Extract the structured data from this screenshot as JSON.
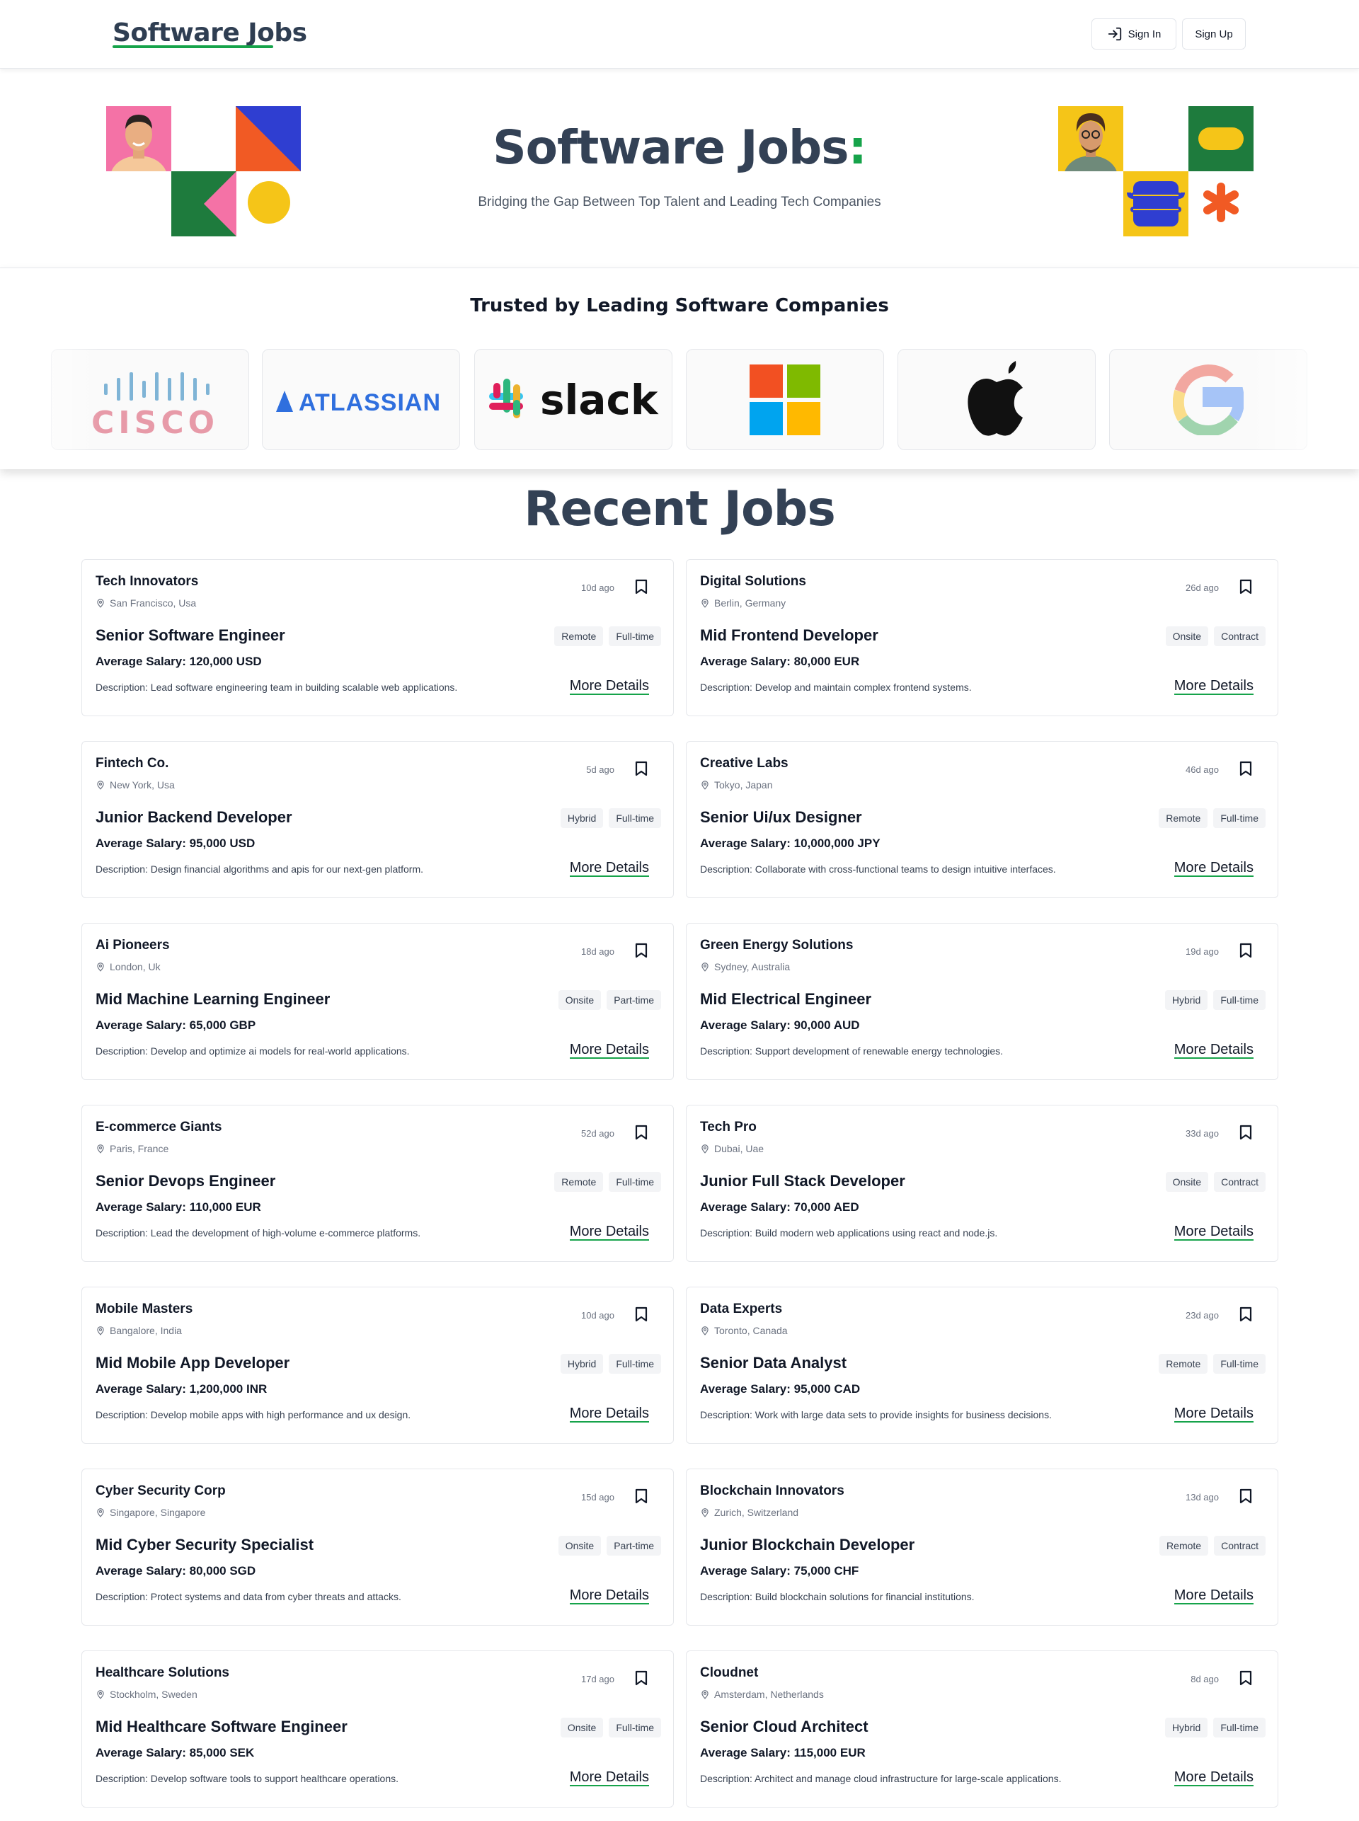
{
  "nav": {
    "brand": "Software Jobs",
    "signin": "Sign In",
    "signup": "Sign Up"
  },
  "hero": {
    "title": "Software Jobs",
    "title_accent": ":",
    "subtitle": "Bridging the Gap Between Top Talent and Leading Tech Companies"
  },
  "trusted": {
    "heading": "Trusted by Leading Software Companies",
    "logos": [
      "cisco",
      "atlassian",
      "slack",
      "microsoft",
      "apple",
      "google"
    ],
    "cisco_text": "CISCO",
    "atlassian_text": "ATLASSIAN",
    "slack_text": "slack"
  },
  "recent": {
    "title": "Recent Jobs"
  },
  "colors": {
    "accent": "#16a34a",
    "heading": "#334155"
  },
  "jobs": [
    {
      "company": "Tech Innovators",
      "location": "San Francisco, Usa",
      "ago": "10d ago",
      "title": "Senior Software Engineer",
      "tags": [
        "Remote",
        "Full-time"
      ],
      "salary": "Average Salary: 120,000 USD",
      "description": "Description: Lead software engineering team in building scalable web applications.",
      "more": "More Details"
    },
    {
      "company": "Digital Solutions",
      "location": "Berlin, Germany",
      "ago": "26d ago",
      "title": "Mid Frontend Developer",
      "tags": [
        "Onsite",
        "Contract"
      ],
      "salary": "Average Salary: 80,000 EUR",
      "description": "Description: Develop and maintain complex frontend systems.",
      "more": "More Details"
    },
    {
      "company": "Fintech Co.",
      "location": "New York, Usa",
      "ago": "5d ago",
      "title": "Junior Backend Developer",
      "tags": [
        "Hybrid",
        "Full-time"
      ],
      "salary": "Average Salary: 95,000 USD",
      "description": "Description: Design financial algorithms and apis for our next-gen platform.",
      "more": "More Details"
    },
    {
      "company": "Creative Labs",
      "location": "Tokyo, Japan",
      "ago": "46d ago",
      "title": "Senior Ui/ux Designer",
      "tags": [
        "Remote",
        "Full-time"
      ],
      "salary": "Average Salary: 10,000,000 JPY",
      "description": "Description: Collaborate with cross-functional teams to design intuitive interfaces.",
      "more": "More Details"
    },
    {
      "company": "Ai Pioneers",
      "location": "London, Uk",
      "ago": "18d ago",
      "title": "Mid Machine Learning Engineer",
      "tags": [
        "Onsite",
        "Part-time"
      ],
      "salary": "Average Salary: 65,000 GBP",
      "description": "Description: Develop and optimize ai models for real-world applications.",
      "more": "More Details"
    },
    {
      "company": "Green Energy Solutions",
      "location": "Sydney, Australia",
      "ago": "19d ago",
      "title": "Mid Electrical Engineer",
      "tags": [
        "Hybrid",
        "Full-time"
      ],
      "salary": "Average Salary: 90,000 AUD",
      "description": "Description: Support development of renewable energy technologies.",
      "more": "More Details"
    },
    {
      "company": "E-commerce Giants",
      "location": "Paris, France",
      "ago": "52d ago",
      "title": "Senior Devops Engineer",
      "tags": [
        "Remote",
        "Full-time"
      ],
      "salary": "Average Salary: 110,000 EUR",
      "description": "Description: Lead the development of high-volume e-commerce platforms.",
      "more": "More Details"
    },
    {
      "company": "Tech Pro",
      "location": "Dubai, Uae",
      "ago": "33d ago",
      "title": "Junior Full Stack Developer",
      "tags": [
        "Onsite",
        "Contract"
      ],
      "salary": "Average Salary: 70,000 AED",
      "description": "Description: Build modern web applications using react and node.js.",
      "more": "More Details"
    },
    {
      "company": "Mobile Masters",
      "location": "Bangalore, India",
      "ago": "10d ago",
      "title": "Mid Mobile App Developer",
      "tags": [
        "Hybrid",
        "Full-time"
      ],
      "salary": "Average Salary: 1,200,000 INR",
      "description": "Description: Develop mobile apps with high performance and ux design.",
      "more": "More Details"
    },
    {
      "company": "Data Experts",
      "location": "Toronto, Canada",
      "ago": "23d ago",
      "title": "Senior Data Analyst",
      "tags": [
        "Remote",
        "Full-time"
      ],
      "salary": "Average Salary: 95,000 CAD",
      "description": "Description: Work with large data sets to provide insights for business decisions.",
      "more": "More Details"
    },
    {
      "company": "Cyber Security Corp",
      "location": "Singapore, Singapore",
      "ago": "15d ago",
      "title": "Mid Cyber Security Specialist",
      "tags": [
        "Onsite",
        "Part-time"
      ],
      "salary": "Average Salary: 80,000 SGD",
      "description": "Description: Protect systems and data from cyber threats and attacks.",
      "more": "More Details"
    },
    {
      "company": "Blockchain Innovators",
      "location": "Zurich, Switzerland",
      "ago": "13d ago",
      "title": "Junior Blockchain Developer",
      "tags": [
        "Remote",
        "Contract"
      ],
      "salary": "Average Salary: 75,000 CHF",
      "description": "Description: Build blockchain solutions for financial institutions.",
      "more": "More Details"
    },
    {
      "company": "Healthcare Solutions",
      "location": "Stockholm, Sweden",
      "ago": "17d ago",
      "title": "Mid Healthcare Software Engineer",
      "tags": [
        "Onsite",
        "Full-time"
      ],
      "salary": "Average Salary: 85,000 SEK",
      "description": "Description: Develop software tools to support healthcare operations.",
      "more": "More Details"
    },
    {
      "company": "Cloudnet",
      "location": "Amsterdam, Netherlands",
      "ago": "8d ago",
      "title": "Senior Cloud Architect",
      "tags": [
        "Hybrid",
        "Full-time"
      ],
      "salary": "Average Salary: 115,000 EUR",
      "description": "Description: Architect and manage cloud infrastructure for large-scale applications.",
      "more": "More Details"
    }
  ]
}
